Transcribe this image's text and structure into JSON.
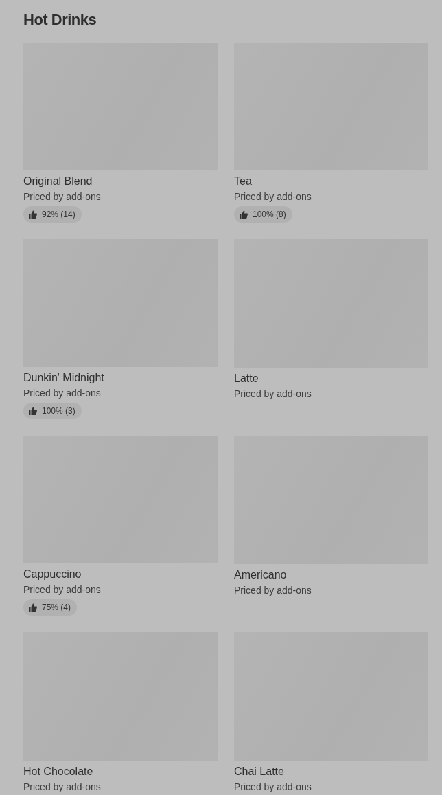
{
  "section": {
    "title": "Hot Drinks"
  },
  "items": [
    {
      "name": "Original Blend",
      "subtitle": "Priced by add-ons",
      "rating": "92% (14)"
    },
    {
      "name": "Tea",
      "subtitle": "Priced by add-ons",
      "rating": "100% (8)"
    },
    {
      "name": "Dunkin' Midnight",
      "subtitle": "Priced by add-ons",
      "rating": "100% (3)"
    },
    {
      "name": "Latte",
      "subtitle": "Priced by add-ons"
    },
    {
      "name": "Cappuccino",
      "subtitle": "Priced by add-ons",
      "rating": "75% (4)"
    },
    {
      "name": "Americano",
      "subtitle": "Priced by add-ons"
    },
    {
      "name": "Hot Chocolate",
      "subtitle": "Priced by add-ons"
    },
    {
      "name": "Chai Latte",
      "subtitle": "Priced by add-ons"
    }
  ]
}
